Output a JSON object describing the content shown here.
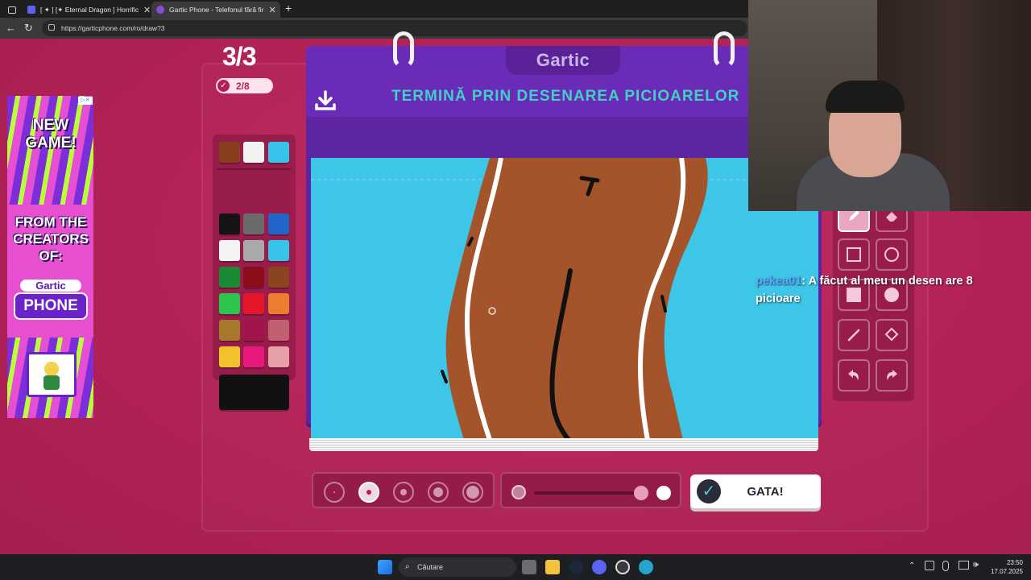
{
  "browser": {
    "tabs": [
      {
        "title": "[ ✦ ] [✦ Eternal Dragon ] Horrific",
        "active": false
      },
      {
        "title": "Gartic Phone - Telefonul fără fir",
        "active": true
      }
    ],
    "new_tab": "+",
    "url": "https://garticphone.com/ro/draw?3"
  },
  "game": {
    "round": "3/3",
    "players_done": "2/8",
    "logo": "Gartic",
    "task": "TERMINĂ PRIN DESENAREA PICIOARELOR",
    "done_label": "GATA!",
    "palette": [
      "#8b3d1f",
      "#f2f2f2",
      "#38c3ea",
      "#141414",
      "#6b6b6b",
      "#1f66c8",
      "#f4f4f4",
      "#a9a9a9",
      "#38c3ea",
      "#1c8a35",
      "#8a0d1b",
      "#8c4420",
      "#2ec34e",
      "#e3162a",
      "#ec7d2f",
      "#a8782d",
      "#a0154d",
      "#c06070",
      "#f2c12e",
      "#e8197d",
      "#e8a0a8"
    ],
    "current_color": "#111111",
    "brush_sizes": [
      "xs",
      "s",
      "m",
      "l",
      "xl"
    ],
    "active_size": 1,
    "tools": [
      "pen",
      "eraser",
      "rectangle",
      "ellipse",
      "filled-rectangle",
      "filled-ellipse",
      "line",
      "fill",
      "undo",
      "redo"
    ],
    "opacity": 1.0
  },
  "chat": {
    "user": "pekea01",
    "message": ": A făcut al meu un desen are 8 picioare"
  },
  "ad": {
    "headline": "NEW GAME!",
    "subline": "FROM THE CREATORS OF:",
    "logo_top": "Gartic",
    "logo_bottom": "PHONE"
  },
  "taskbar": {
    "search_placeholder": "Căutare",
    "time": "23:50",
    "date": "17.07.2025"
  },
  "colors": {
    "page_bg": "#b52358",
    "board": "#6a2bb6",
    "task_text": "#3fd1c8",
    "canvas": "#3ec6e9",
    "drawing_brown": "#a3542a"
  }
}
